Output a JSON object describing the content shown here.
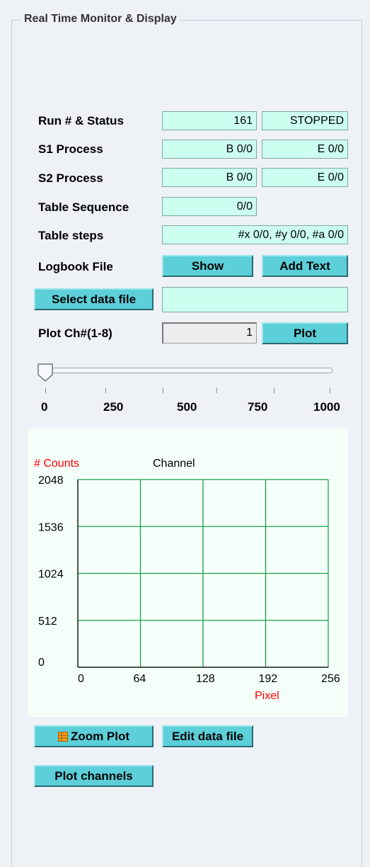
{
  "panel_title": "Real Time Monitor & Display",
  "rows": {
    "run_status": {
      "label": "Run # & Status",
      "run_number": "161",
      "status": "STOPPED"
    },
    "s1_process": {
      "label": "S1 Process",
      "b": "B 0/0",
      "e": "E 0/0"
    },
    "s2_process": {
      "label": "S2 Process",
      "b": "B 0/0",
      "e": "E 0/0"
    },
    "table_sequence": {
      "label": "Table Sequence",
      "value": "0/0"
    },
    "table_steps": {
      "label": "Table steps",
      "value": "#x 0/0, #y 0/0, #a 0/0"
    },
    "logbook": {
      "label": "Logbook File",
      "show_button": "Show",
      "add_text_button": "Add Text"
    },
    "data_file": {
      "button": "Select data file",
      "value": ""
    },
    "plot_channel": {
      "label": "Plot Ch#(1-8)",
      "value": "1",
      "plot_button": "Plot"
    }
  },
  "slider": {
    "value": 0,
    "min": 0,
    "max": 1000,
    "tick_labels": [
      "0",
      "250",
      "500",
      "750",
      "1000"
    ]
  },
  "chart_data": {
    "type": "line",
    "title": "Channel",
    "ylabel": "# Counts",
    "xlabel": "Pixel",
    "xlim": [
      0,
      256
    ],
    "ylim": [
      0,
      2048
    ],
    "x_ticks": [
      "0",
      "64",
      "128",
      "192",
      "256"
    ],
    "y_ticks": [
      "0",
      "512",
      "1024",
      "1536",
      "2048"
    ],
    "grid": true,
    "series": [],
    "colors": {
      "grid": "#1aa04a",
      "axis_label": "#ff0000"
    }
  },
  "buttons": {
    "zoom_plot": "Zoom Plot",
    "edit_data_file": "Edit data file",
    "plot_channels": "Plot channels"
  },
  "colors": {
    "field_bg": "#ccfff0",
    "button_bg": "#5ccfd9"
  }
}
